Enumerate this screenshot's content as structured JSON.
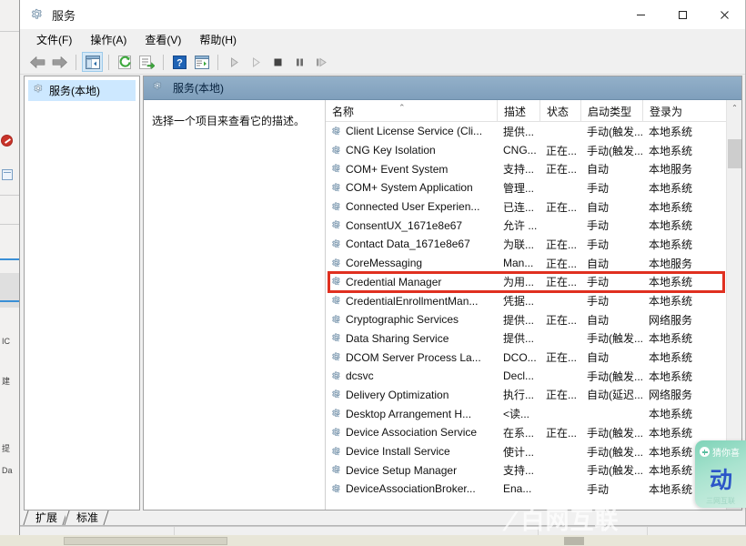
{
  "window": {
    "title": "服务",
    "icon": "services-gear-icon",
    "controls": {
      "minimize": "—",
      "maximize": "☐",
      "close": "✕"
    }
  },
  "menubar": [
    {
      "label": "文件(F)",
      "name": "menu-file"
    },
    {
      "label": "操作(A)",
      "name": "menu-action"
    },
    {
      "label": "查看(V)",
      "name": "menu-view"
    },
    {
      "label": "帮助(H)",
      "name": "menu-help"
    }
  ],
  "toolbar": [
    {
      "name": "back-button",
      "icon": "arrow-left-icon"
    },
    {
      "name": "forward-button",
      "icon": "arrow-right-icon"
    },
    {
      "name": "show-hide-tree-button",
      "icon": "tree-pane-icon",
      "selected": true
    },
    {
      "name": "refresh-button",
      "icon": "refresh-icon"
    },
    {
      "name": "export-list-button",
      "icon": "export-icon"
    },
    {
      "name": "help-button",
      "icon": "question-mark-icon"
    },
    {
      "name": "properties-button",
      "icon": "properties-window-icon"
    },
    {
      "name": "start-service-button",
      "icon": "play-icon"
    },
    {
      "name": "resume-service-button",
      "icon": "play-outline-icon"
    },
    {
      "name": "stop-service-button",
      "icon": "stop-icon"
    },
    {
      "name": "pause-service-button",
      "icon": "pause-icon"
    },
    {
      "name": "restart-service-button",
      "icon": "restart-icon"
    }
  ],
  "tree": {
    "node_label": "服务(本地)",
    "node_icon": "services-gear-icon"
  },
  "right_header": {
    "label": "服务(本地)",
    "icon": "services-gear-icon"
  },
  "description_pane": {
    "text": "选择一个项目来查看它的描述。"
  },
  "list": {
    "columns": [
      {
        "label": "名称",
        "width": 188,
        "sorted": "asc",
        "sort_glyph": "⌃"
      },
      {
        "label": "描述",
        "width": 47
      },
      {
        "label": "状态",
        "width": 45
      },
      {
        "label": "启动类型",
        "width": 68
      },
      {
        "label": "登录为",
        "width": 58
      }
    ],
    "rows": [
      {
        "name": "Client License Service (Cli...",
        "desc": "提供...",
        "status": "",
        "startup": "手动(触发...",
        "logon": "本地系统"
      },
      {
        "name": "CNG Key Isolation",
        "desc": "CNG...",
        "status": "正在...",
        "startup": "手动(触发...",
        "logon": "本地系统"
      },
      {
        "name": "COM+ Event System",
        "desc": "支持...",
        "status": "正在...",
        "startup": "自动",
        "logon": "本地服务"
      },
      {
        "name": "COM+ System Application",
        "desc": "管理...",
        "status": "",
        "startup": "手动",
        "logon": "本地系统"
      },
      {
        "name": "Connected User Experien...",
        "desc": "已连...",
        "status": "正在...",
        "startup": "自动",
        "logon": "本地系统"
      },
      {
        "name": "ConsentUX_1671e8e67",
        "desc": "允许 ...",
        "status": "",
        "startup": "手动",
        "logon": "本地系统"
      },
      {
        "name": "Contact Data_1671e8e67",
        "desc": "为联...",
        "status": "正在...",
        "startup": "手动",
        "logon": "本地系统"
      },
      {
        "name": "CoreMessaging",
        "desc": "Man...",
        "status": "正在...",
        "startup": "自动",
        "logon": "本地服务"
      },
      {
        "name": "Credential Manager",
        "desc": "为用...",
        "status": "正在...",
        "startup": "手动",
        "logon": "本地系统",
        "highlighted": true
      },
      {
        "name": "CredentialEnrollmentMan...",
        "desc": "凭据...",
        "status": "",
        "startup": "手动",
        "logon": "本地系统"
      },
      {
        "name": "Cryptographic Services",
        "desc": "提供...",
        "status": "正在...",
        "startup": "自动",
        "logon": "网络服务"
      },
      {
        "name": "Data Sharing Service",
        "desc": "提供...",
        "status": "",
        "startup": "手动(触发...",
        "logon": "本地系统"
      },
      {
        "name": "DCOM Server Process La...",
        "desc": "DCO...",
        "status": "正在...",
        "startup": "自动",
        "logon": "本地系统"
      },
      {
        "name": "dcsvc",
        "desc": "Decl...",
        "status": "",
        "startup": "手动(触发...",
        "logon": "本地系统"
      },
      {
        "name": "Delivery Optimization",
        "desc": "执行...",
        "status": "正在...",
        "startup": "自动(延迟...",
        "logon": "网络服务"
      },
      {
        "name": "Desktop Arrangement H...",
        "desc": "<读...",
        "status": "",
        "startup": "",
        "logon": "本地系统"
      },
      {
        "name": "Device Association Service",
        "desc": "在系...",
        "status": "正在...",
        "startup": "手动(触发...",
        "logon": "本地系统"
      },
      {
        "name": "Device Install Service",
        "desc": "使计...",
        "status": "",
        "startup": "手动(触发...",
        "logon": "本地系统"
      },
      {
        "name": "Device Setup Manager",
        "desc": "支持...",
        "status": "",
        "startup": "手动(触发...",
        "logon": "本地系统"
      },
      {
        "name": "DeviceAssociationBroker...",
        "desc": "Ena...",
        "status": "",
        "startup": "手动",
        "logon": "本地系统"
      }
    ]
  },
  "annotation": {
    "color": "#e03020",
    "target_row": "Credential Manager"
  },
  "scrollbar": {
    "up_glyph": "⌃",
    "down_glyph": "⌄"
  },
  "tabs": [
    {
      "label": "扩展",
      "name": "tab-extended",
      "active": false
    },
    {
      "label": "标准",
      "name": "tab-standard",
      "active": true
    }
  ],
  "promo": {
    "title": "猜你喜",
    "big_text": "动",
    "footer": "三网互联"
  },
  "watermark": {
    "text": "白网互联"
  },
  "colors": {
    "accent": "#cde8ff",
    "header_gradient_top": "#93b0c9",
    "annotation_red": "#e03020",
    "promo_green": "#7fd3b8"
  }
}
